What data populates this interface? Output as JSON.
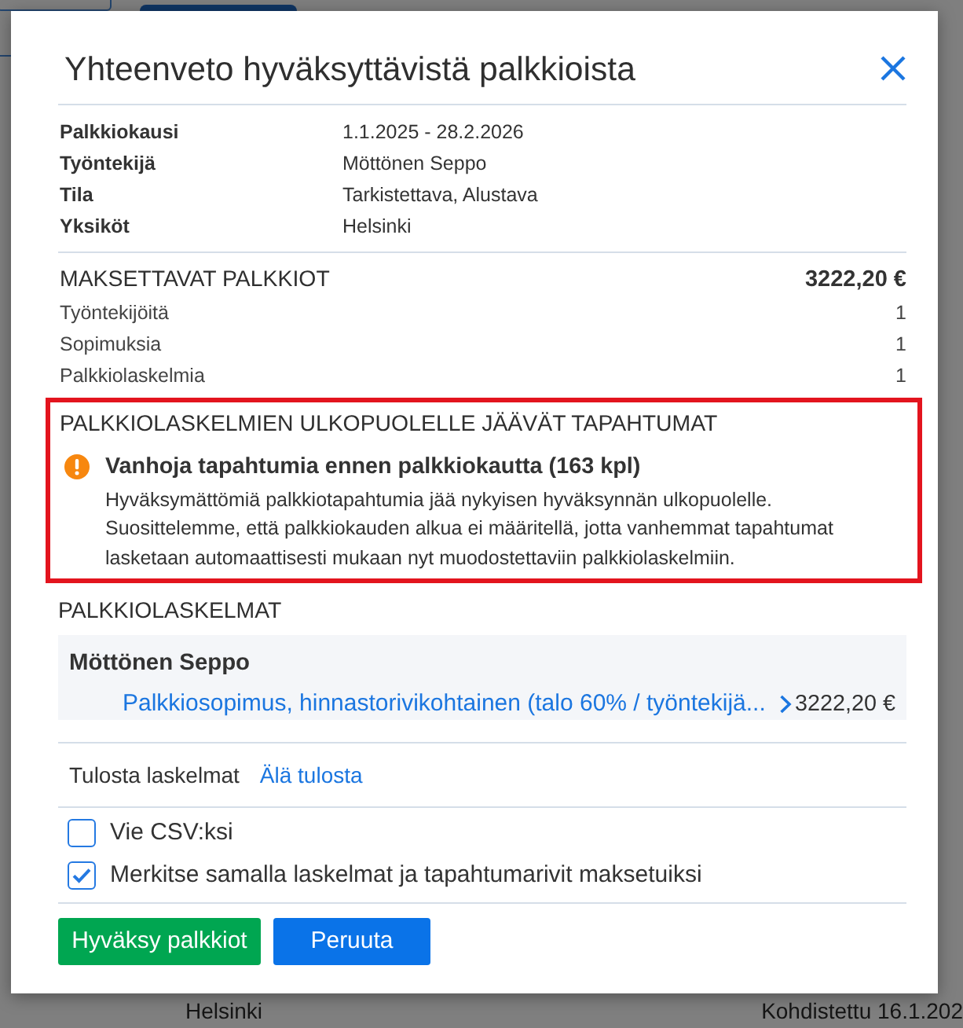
{
  "dialog": {
    "title": "Yhteenveto hyväksyttävistä palkkioista"
  },
  "details": [
    {
      "label": "Palkkiokausi",
      "value": "1.1.2025 - 28.2.2026"
    },
    {
      "label": "Työntekijä",
      "value": "Möttönen Seppo"
    },
    {
      "label": "Tila",
      "value": "Tarkistettava, Alustava"
    },
    {
      "label": "Yksiköt",
      "value": "Helsinki"
    }
  ],
  "payable": {
    "title": "MAKSETTAVAT PALKKIOT",
    "total": "3222,20 €",
    "rows": [
      {
        "label": "Työntekijöitä",
        "value": "1"
      },
      {
        "label": "Sopimuksia",
        "value": "1"
      },
      {
        "label": "Palkkiolaskelmia",
        "value": "1"
      }
    ]
  },
  "excluded_events": {
    "title": "PALKKIOLASKELMIEN ULKOPUOLELLE JÄÄVÄT TAPAHTUMAT",
    "highlighted": true,
    "notices": [
      {
        "kind": "warning",
        "title": "Vanhoja tapahtumia ennen palkkiokautta (163 kpl)",
        "text": "Hyväksymättömiä palkkiotapahtumia jää nykyisen hyväksynnän ulkopuolelle. Suosittelemme, että palkkiokauden alkua ei määritellä, jotta vanhemmat tapahtumat lasketaan automaattisesti mukaan nyt muodostettaviin palkkiolaskelmiin."
      }
    ]
  },
  "calculations": {
    "title": "PALKKIOLASKELMAT",
    "employees": [
      {
        "name": "Möttönen Seppo",
        "items": [
          {
            "link": "Palkkiosopimus, hinnastorivikohtainen (talo 60% / työntekijä...",
            "amount": "3222,20 €"
          }
        ]
      }
    ]
  },
  "print": {
    "label": "Tulosta laskelmat",
    "link": "Älä tulosta"
  },
  "options": [
    {
      "label": "Vie CSV:ksi",
      "checked": false
    },
    {
      "label": "Merkitse samalla laskelmat ja tapahtumarivit maksetuiksi",
      "checked": true
    }
  ],
  "buttons": [
    {
      "label": "Hyväksy palkkiot",
      "kind": "approve"
    },
    {
      "label": "Peruuta",
      "kind": "cancel"
    }
  ],
  "background_row": {
    "column_1": "Helsinki",
    "column_2": "Kohdistettu 16.1.202"
  }
}
